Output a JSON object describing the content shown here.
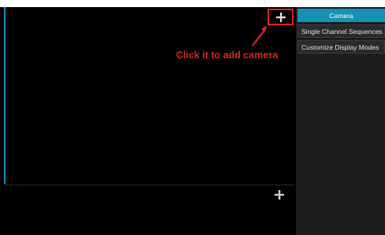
{
  "annotation": {
    "text": "Click it to add camera",
    "color": "#e02020"
  },
  "panes": [
    {
      "add_icon": "plus-icon",
      "highlighted": true
    },
    {
      "add_icon": "plus-icon",
      "highlighted": false
    }
  ],
  "sidebar": {
    "items": [
      {
        "label": "Camera",
        "active": true
      },
      {
        "label": "Single Channel Sequences",
        "active": false
      },
      {
        "label": "Customize Display Modes",
        "active": false
      }
    ]
  },
  "colors": {
    "accent": "#1591b4",
    "highlight": "#e02020",
    "background": "#000000",
    "sidebar": "#1d1d1d"
  }
}
